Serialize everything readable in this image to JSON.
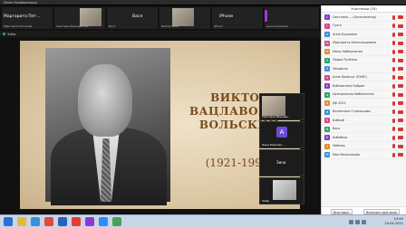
{
  "window": {
    "title": "Zoom Конференция"
  },
  "top_tiles": [
    {
      "name": "Маргарита  Пет...",
      "sub": "Маргарита Петрова",
      "type": "name"
    },
    {
      "name": "",
      "sub": "Светлана Вишневская",
      "type": "cam"
    },
    {
      "name": "Вася",
      "sub": "Вася",
      "type": "name"
    },
    {
      "name": "",
      "sub": "Библиотека",
      "type": "cam"
    },
    {
      "name": "iPhone",
      "sub": "iPhone",
      "type": "name"
    },
    {
      "name": "A",
      "sub": "Анна Кирилова",
      "type": "avatar"
    }
  ],
  "share_bar": {
    "label": "Зибы"
  },
  "slide": {
    "title_lines": [
      "ВИКТОР",
      "ВАЦЛАВОВИЧ",
      "ВОЛЬСКИЙ"
    ],
    "years": "(1921-1999)"
  },
  "mini_tiles": [
    {
      "label": "Светлана Вишнев...",
      "type": "cam"
    },
    {
      "label": "Лена Картовк...",
      "type": "avatar",
      "letter": "A"
    },
    {
      "label": "Зина",
      "type": "name"
    },
    {
      "label": "Зибы",
      "type": "cam"
    }
  ],
  "participants_panel": {
    "header": "Участники (20)",
    "participants": [
      {
        "name": "Светлана ... (Организатор)",
        "color": "#7a3fc7",
        "letter": "С"
      },
      {
        "name": "Грэга",
        "color": "#d9428a",
        "letter": "Г"
      },
      {
        "name": "Анна Кузьмина",
        "color": "#3a8fd9",
        "letter": "А"
      },
      {
        "name": "Маргарита Александровна",
        "color": "#d9428a",
        "letter": "М"
      },
      {
        "name": "Мила Набережная",
        "color": "#e08a2a",
        "letter": "М"
      },
      {
        "name": "Лидия Рулёнка",
        "color": "#2aa36a",
        "letter": "Л"
      },
      {
        "name": "Людмила",
        "color": "#3a8fd9",
        "letter": "Л"
      },
      {
        "name": "Алла Кравчук (ПАЛЕ)",
        "color": "#d9428a",
        "letter": "А"
      },
      {
        "name": "Библиотека Кобрин",
        "color": "#7a3fc7",
        "letter": "Б"
      },
      {
        "name": "Центральная библиотека",
        "color": "#2aa36a",
        "letter": "Ц"
      },
      {
        "name": "ДБ 2021",
        "color": "#e08a2a",
        "letter": "Д"
      },
      {
        "name": "Валентина Стрельцова",
        "color": "#3a8fd9",
        "letter": "В"
      },
      {
        "name": "Бибкой",
        "color": "#d9428a",
        "letter": "Б"
      },
      {
        "name": "Вася",
        "color": "#2aa36a",
        "letter": "В"
      },
      {
        "name": "Бибиблог",
        "color": "#7a3fc7",
        "letter": "Б"
      },
      {
        "name": "Любовь",
        "color": "#e08a2a",
        "letter": "Л"
      },
      {
        "name": "Мая Мельникова",
        "color": "#3a8fd9",
        "letter": "М"
      }
    ],
    "footer_buttons": [
      "Всех выкл.",
      "Включить звук всем"
    ]
  },
  "taskbar": {
    "icons": [
      "start-icon",
      "folder-icon",
      "browser-icon",
      "chrome-icon",
      "word-icon",
      "yandex-icon",
      "music-icon",
      "zoom-icon",
      "app-icon"
    ],
    "time": "15:40",
    "date": "24.04.2021"
  }
}
